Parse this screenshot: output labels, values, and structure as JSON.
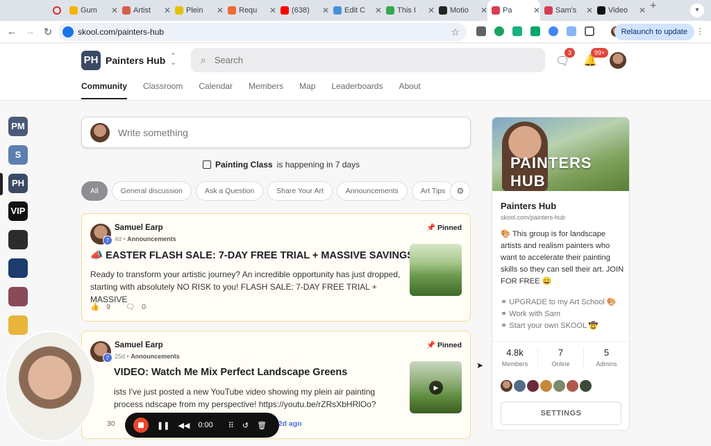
{
  "browser": {
    "tabs": [
      {
        "label": "Gum",
        "color": "#f4b400",
        "active": false
      },
      {
        "label": "Artist",
        "color": "#d95c4b",
        "active": false
      },
      {
        "label": "Plein",
        "color": "#e6c200",
        "active": false
      },
      {
        "label": "Requ",
        "color": "#f06a35",
        "active": false
      },
      {
        "label": "(638)",
        "color": "#ff0000",
        "active": false
      },
      {
        "label": "Edit C",
        "color": "#4a90d9",
        "active": false
      },
      {
        "label": "This I",
        "color": "#34a853",
        "active": false
      },
      {
        "label": "Motio",
        "color": "#222222",
        "active": false
      },
      {
        "label": "Pa",
        "color": "#d93c52",
        "active": true
      },
      {
        "label": "Sam's",
        "color": "#d93c52",
        "active": false
      },
      {
        "label": "Video",
        "color": "#111111",
        "active": false
      }
    ],
    "url": "skool.com/painters-hub",
    "relaunch_label": "Relaunch to update"
  },
  "header": {
    "logo_text": "PH",
    "group_name": "Painters Hub",
    "search_placeholder": "Search",
    "chat_badge": "3",
    "notif_badge": "99+",
    "tabs": [
      "Community",
      "Classroom",
      "Calendar",
      "Members",
      "Map",
      "Leaderboards",
      "About"
    ]
  },
  "left_rail": [
    {
      "label": "PM",
      "color": "#4a5a78"
    },
    {
      "label": "S",
      "color": "#5b7fb0"
    },
    {
      "label": "PH",
      "color": "#3a4a64"
    },
    {
      "label": "VIP",
      "color": "#111111"
    },
    {
      "label": "",
      "color": "#2c2c2c"
    },
    {
      "label": "",
      "color": "#1d3c6e"
    },
    {
      "label": "",
      "color": "#8a4a5a"
    },
    {
      "label": "",
      "color": "#e8b53a"
    }
  ],
  "composer": {
    "placeholder": "Write something"
  },
  "event": {
    "name": "Painting Class",
    "text": "is happening in 7 days"
  },
  "chips": [
    "All",
    "General discussion",
    "Ask a Question",
    "Share Your Art",
    "Announcements",
    "Art Tips"
  ],
  "posts": [
    {
      "author": "Samuel Earp",
      "level": "7",
      "time": "4d",
      "category": "Announcements",
      "pinned_label": "Pinned",
      "title": "EASTER FLASH SALE: 7-DAY FREE TRIAL + MASSIVE SAVINGS",
      "title_emoji": "📣",
      "body": "Ready to transform your artistic journey? An incredible opportunity has just dropped, starting with absolutely NO RISK to you! FLASH SALE: 7-DAY FREE TRIAL + MASSIVE",
      "likes": "9",
      "comments": "0"
    },
    {
      "author": "Samuel Earp",
      "level": "7",
      "time": "25d",
      "category": "Announcements",
      "pinned_label": "Pinned",
      "title": "VIDEO: Watch Me Mix Perfect Landscape Greens",
      "body": "ists I've just posted a new YouTube video showing my plein air painting process ndscape from my perspective! https://youtu.be/rZRsXbHRlOo?",
      "likes": "30",
      "last_comment": "2d ago"
    }
  ],
  "sidebar": {
    "cover_brand": "PAINTERS HUB",
    "name": "Painters Hub",
    "url": "skool.com/painters-hub",
    "description": "🎨 This group is for landscape artists and realism painters who want to accelerate their painting skills so they can sell their art. JOIN FOR FREE 😀",
    "links": [
      "UPGRADE to my Art School 🎨",
      "Work with Sam",
      "Start your own SKOOL 🤠"
    ],
    "stats": [
      {
        "value": "4.8k",
        "label": "Members"
      },
      {
        "value": "7",
        "label": "Online"
      },
      {
        "value": "5",
        "label": "Admins"
      }
    ],
    "settings_label": "SETTINGS"
  },
  "recorder": {
    "time": "0:00"
  }
}
